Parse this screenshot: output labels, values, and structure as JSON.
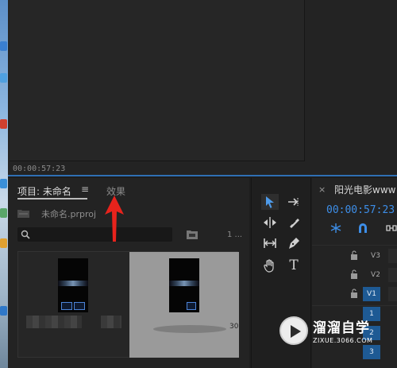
{
  "monitor": {
    "timecode": "00:00:57:23"
  },
  "project_panel": {
    "tab_project": "项目: 未命名",
    "tab_menu": "≡",
    "tab_effects": "效果",
    "file_name": "未命名.prproj",
    "item_count": "1 ..."
  },
  "clips": [
    {
      "card_text": ""
    },
    {
      "card_text": "30"
    }
  ],
  "tools": [
    "selection-tool",
    "track-select-tool",
    "ripple-edit-tool",
    "razor-tool",
    "slip-tool",
    "pen-tool",
    "hand-tool",
    "type-tool"
  ],
  "tools_text": {
    "type_tool_label": "T"
  },
  "timeline": {
    "close": "×",
    "title": "阳光电影www",
    "timecode": "00:00:57:23",
    "tracks": [
      {
        "label": "V3",
        "active": false
      },
      {
        "label": "V2",
        "active": false
      },
      {
        "label": "V1",
        "active": true
      }
    ],
    "audio_tracks": [
      "1",
      "2",
      "3"
    ]
  },
  "watermark": {
    "title": "溜溜自学",
    "url": "ZIXUE.3066.COM"
  },
  "colors": {
    "accent": "#2f6fb4",
    "timecode": "#3d8ee8",
    "arrow": "#e8231c"
  }
}
